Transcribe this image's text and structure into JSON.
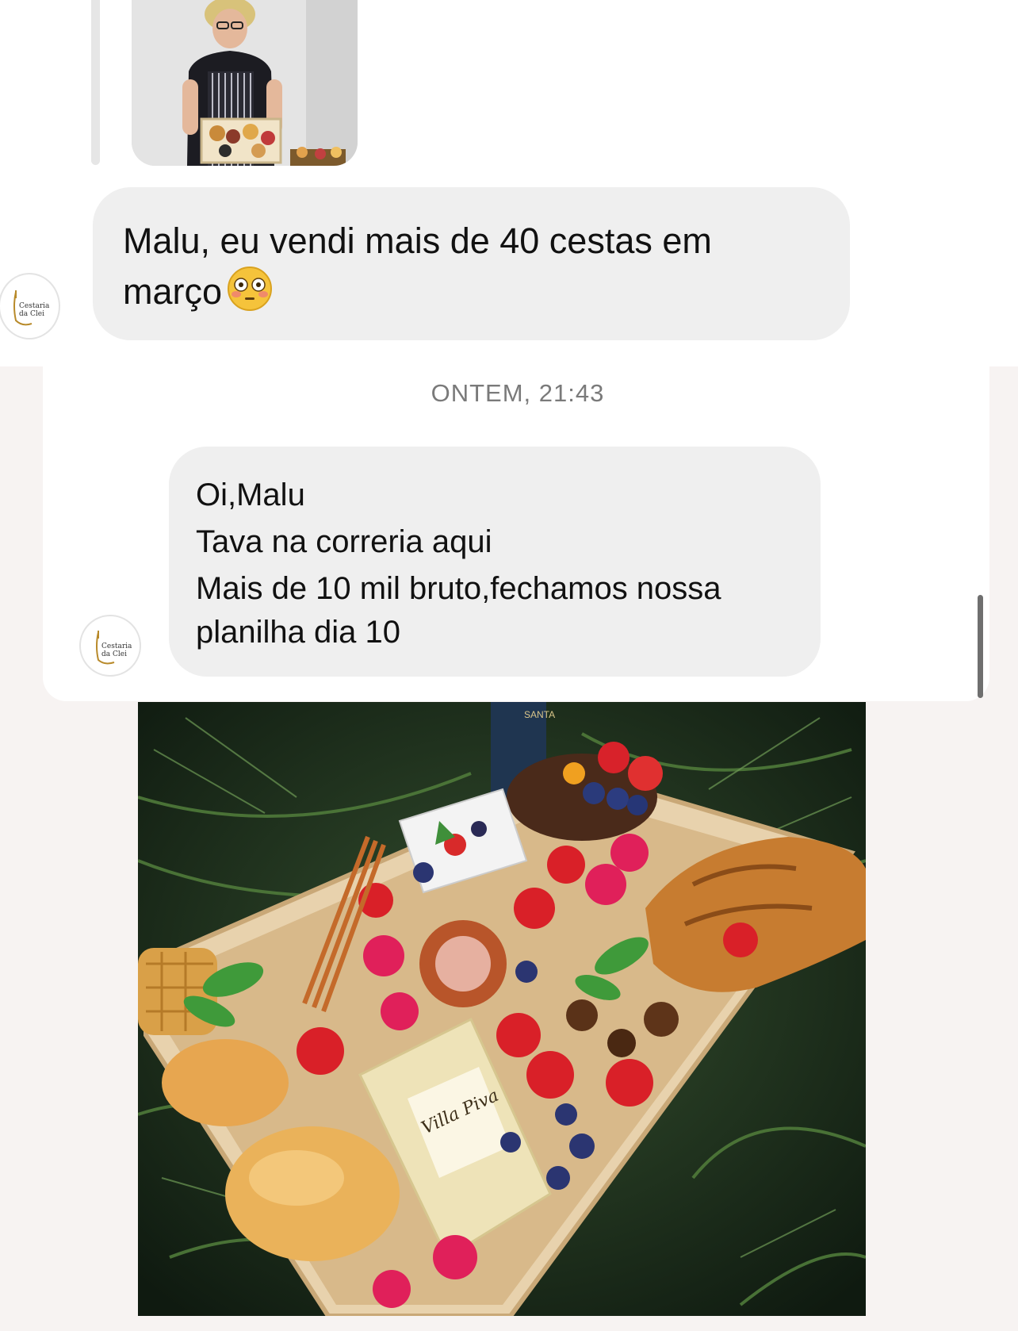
{
  "thread": {
    "messages": [
      {
        "sender_brand": "Cestaria da Clei",
        "text": "Malu, eu vendi mais de 40 cestas em março",
        "emoji": "flushed-face-emoji"
      }
    ],
    "timestamp": "ONTEM, 21:43",
    "second_message": {
      "sender_brand": "Cestaria da Clei",
      "lines": [
        "Oi,Malu",
        "Tava na correria aqui",
        "Mais de 10 mil bruto,fechamos nossa",
        "planilha dia 10"
      ]
    },
    "avatar": {
      "line1": "Cestaria",
      "line2": "da Clei"
    },
    "photo_product_text": {
      "bottle_label": "Villa Piva",
      "bag_label": "SANTA"
    }
  },
  "colors": {
    "bubble": "#efefef",
    "background": "#f7f3f2",
    "timestamp": "#7a7a7a",
    "brand_gold": "#b88a2a"
  }
}
